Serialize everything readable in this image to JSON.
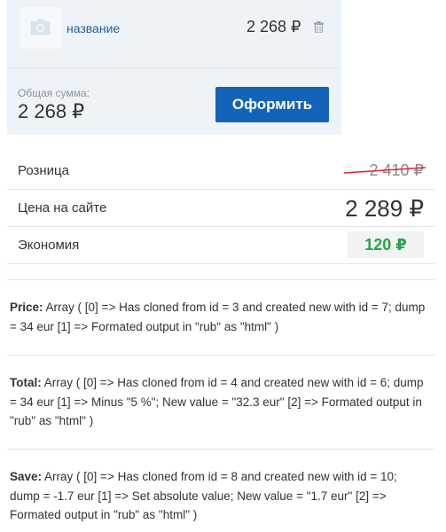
{
  "cart": {
    "item": {
      "name": "название",
      "price": "2 268 ₽"
    },
    "total": {
      "label": "Общая сумма:",
      "value": "2 268 ₽"
    },
    "checkout_label": "Оформить"
  },
  "prices": {
    "retail": {
      "label": "Розница",
      "value": "2 410 ₽"
    },
    "site": {
      "label": "Цена на сайте",
      "value": "2 289 ₽"
    },
    "savings": {
      "label": "Экономия",
      "value": "120 ₽"
    }
  },
  "debug": [
    {
      "title": "Price:",
      "text": "Array ( [0] => Has cloned from id = 3 and created new with id = 7; dump = 34 eur [1] => Formated output in \"rub\" as \"html\" )"
    },
    {
      "title": "Total:",
      "text": "Array ( [0] => Has cloned from id = 4 and created new with id = 6; dump = 34 eur [1] => Minus \"5 %\"; New value = \"32.3 eur\" [2] => Formated output in \"rub\" as \"html\" )"
    },
    {
      "title": "Save:",
      "text": "Array ( [0] => Has cloned from id = 8 and created new with id = 10; dump = -1.7 eur [1] => Set absolute value; New value = \"1.7 eur\" [2] => Formated output in \"rub\" as \"html\" )"
    }
  ],
  "colors": {
    "accent": "#1363b8",
    "link": "#1d5f9e",
    "savings": "#27a34a",
    "strike": "#e0242b",
    "panel": "#eef3f8"
  },
  "icons": {
    "thumbnail": "camera-icon",
    "remove": "trash-icon"
  }
}
